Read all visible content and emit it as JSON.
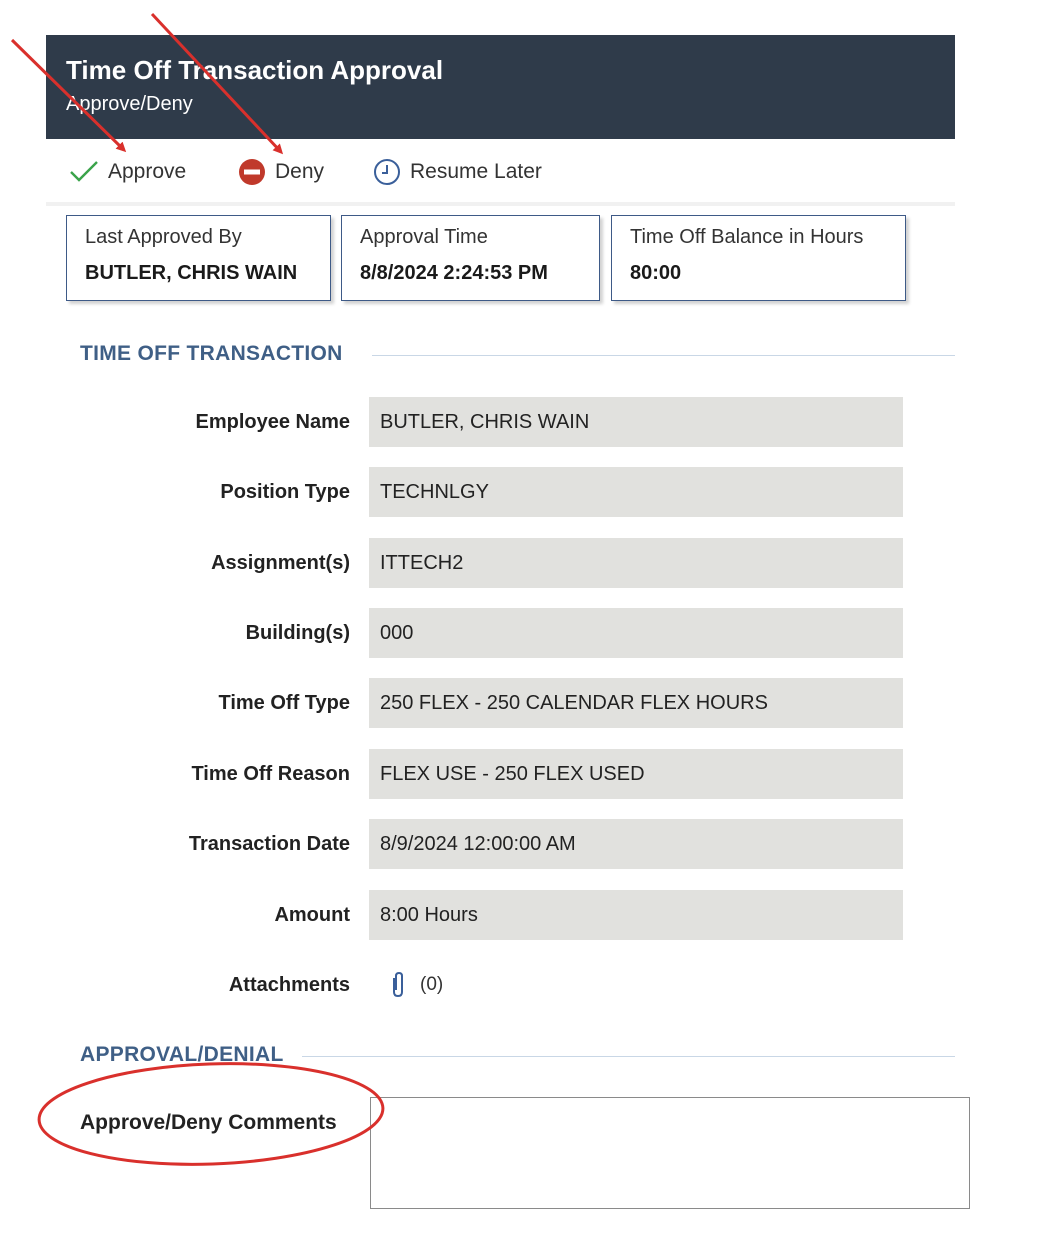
{
  "header": {
    "title": "Time Off Transaction Approval",
    "subtitle": "Approve/Deny"
  },
  "toolbar": {
    "approve_label": "Approve",
    "deny_label": "Deny",
    "resume_label": "Resume Later"
  },
  "summary_cards": [
    {
      "label": "Last Approved By",
      "value": "BUTLER, CHRIS WAIN"
    },
    {
      "label": "Approval Time",
      "value": "8/8/2024 2:24:53 PM"
    },
    {
      "label": "Time Off Balance in Hours",
      "value": "80:00"
    }
  ],
  "transaction": {
    "section_title": "TIME OFF TRANSACTION",
    "fields": [
      {
        "label": "Employee Name",
        "value": "BUTLER, CHRIS WAIN"
      },
      {
        "label": "Position Type",
        "value": "TECHNLGY"
      },
      {
        "label": "Assignment(s)",
        "value": "ITTECH2"
      },
      {
        "label": "Building(s)",
        "value": "000"
      },
      {
        "label": "Time Off Type",
        "value": "250 FLEX - 250 CALENDAR FLEX HOURS"
      },
      {
        "label": "Time Off Reason",
        "value": "FLEX USE - 250 FLEX USED"
      },
      {
        "label": "Transaction Date",
        "value": "8/9/2024 12:00:00 AM"
      },
      {
        "label": "Amount",
        "value": "8:00 Hours"
      }
    ],
    "attachments_label": "Attachments",
    "attachments_count": "(0)"
  },
  "approval": {
    "section_title": "APPROVAL/DENIAL",
    "comments_label": "Approve/Deny Comments",
    "comments_value": ""
  },
  "colors": {
    "header_bg": "#2f3b4a",
    "section_title": "#3f5f86",
    "annotation_red": "#d9302c",
    "approve_green": "#3aa34a",
    "deny_red": "#c0392b",
    "resume_blue": "#3a5f9a"
  },
  "icons": [
    "check-icon",
    "deny-icon",
    "clock-icon",
    "paperclip-icon"
  ]
}
